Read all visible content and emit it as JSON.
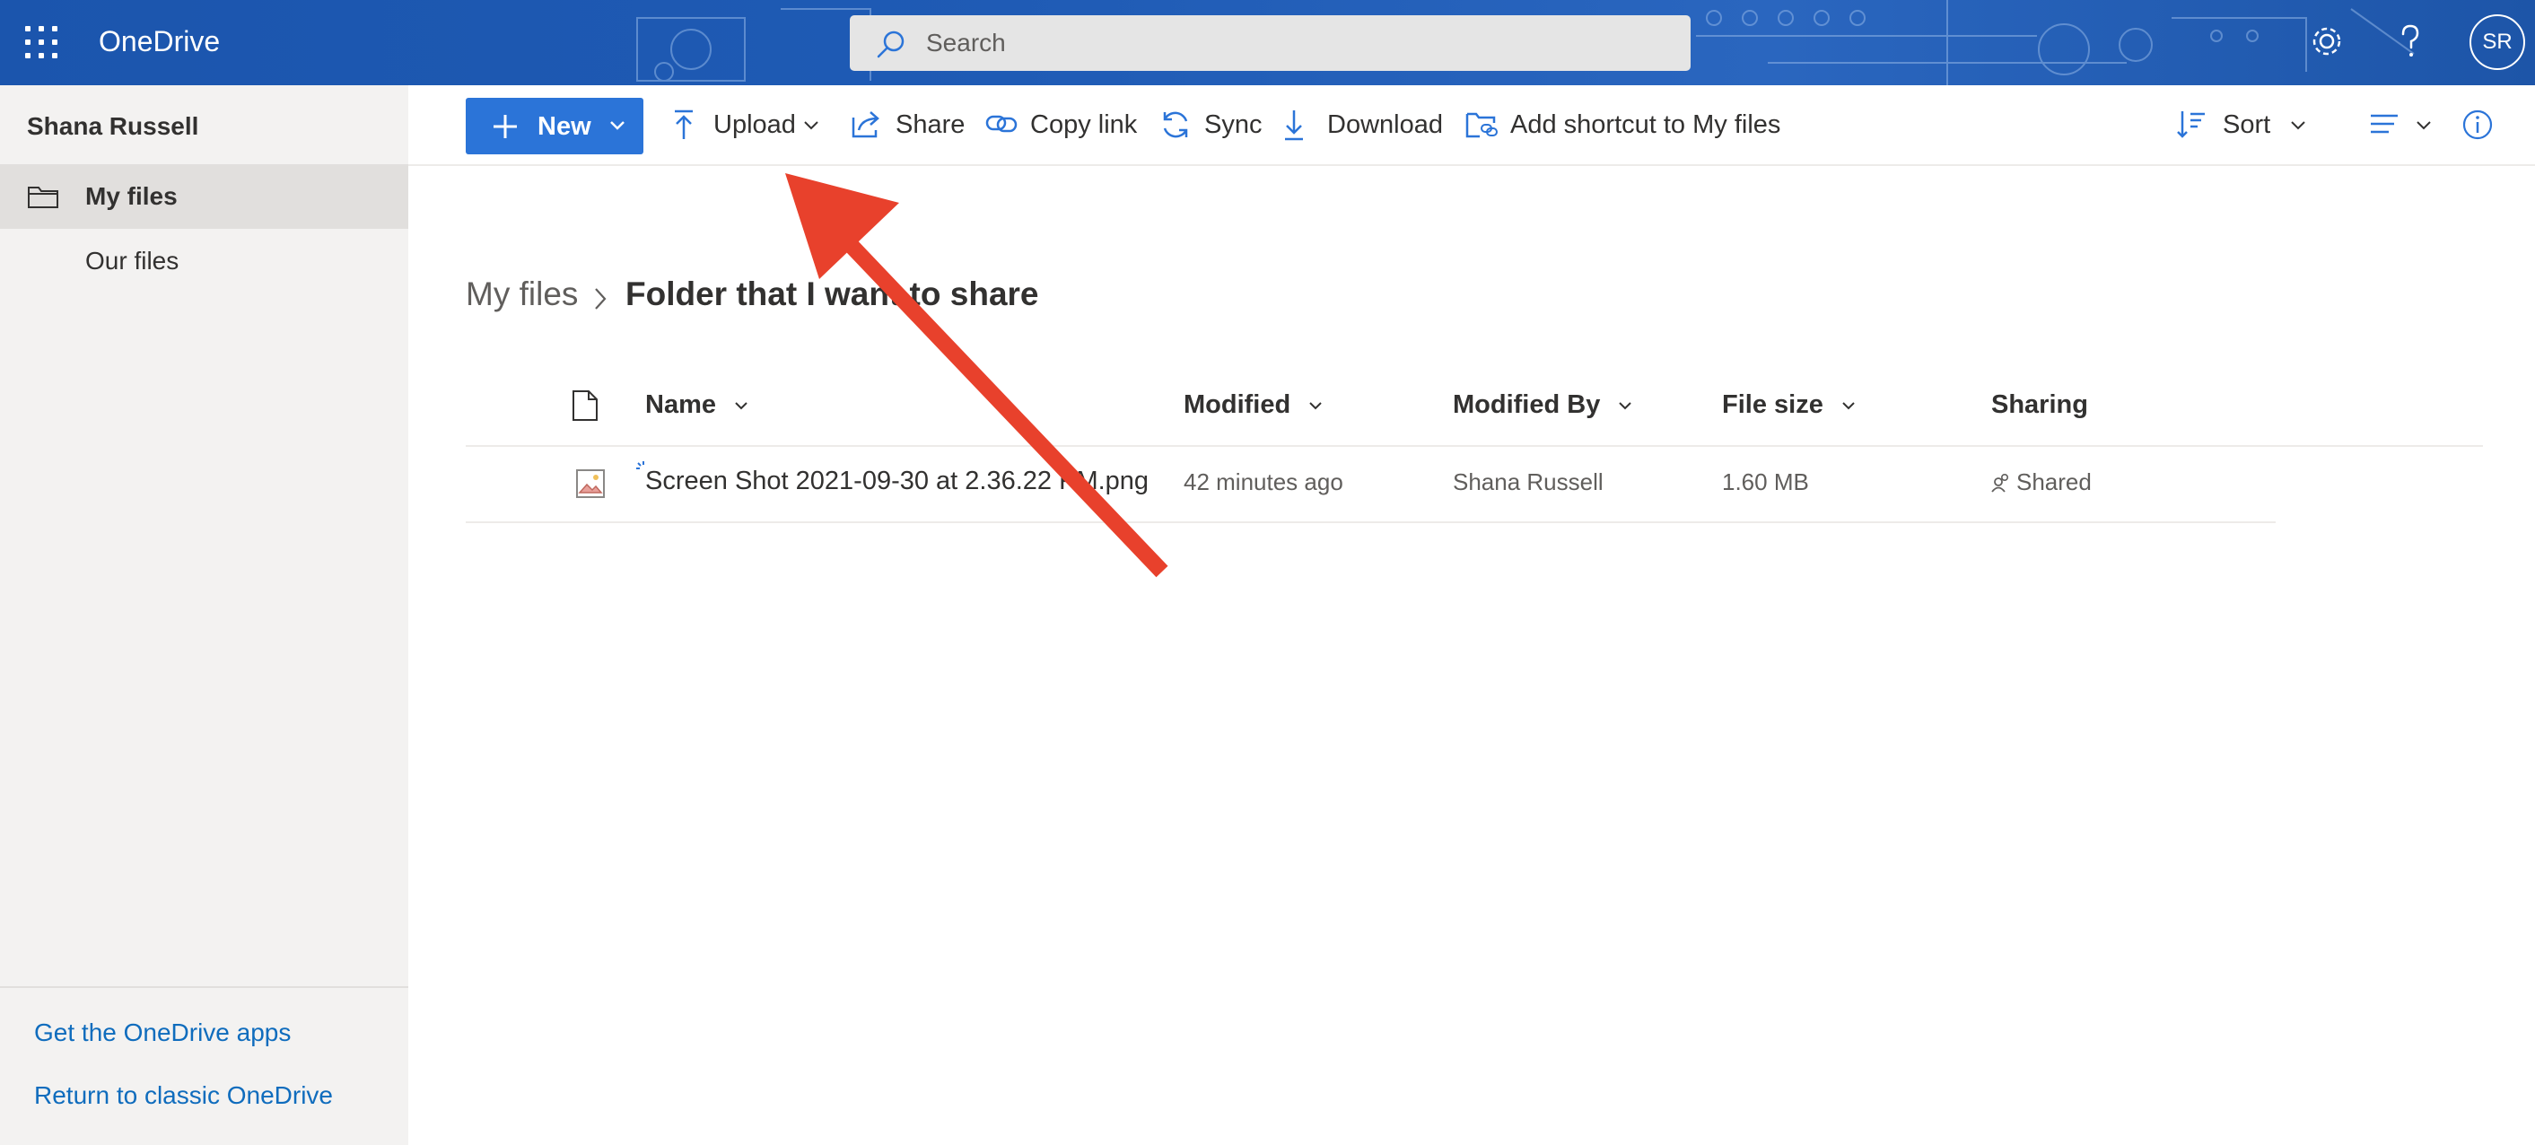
{
  "app": {
    "title": "OneDrive"
  },
  "search": {
    "placeholder": "Search"
  },
  "header": {
    "avatar_initials": "SR",
    "icons": [
      "app-launcher-icon",
      "gear-icon",
      "help-icon"
    ]
  },
  "sidebar": {
    "user_name": "Shana Russell",
    "items": [
      {
        "label": "My files",
        "icon": "folder-icon",
        "active": true
      },
      {
        "label": "Our files"
      }
    ],
    "footer_links": [
      "Get the OneDrive apps",
      "Return to classic OneDrive"
    ]
  },
  "toolbar": {
    "new_label": "New",
    "upload_label": "Upload",
    "share_label": "Share",
    "copy_link_label": "Copy link",
    "sync_label": "Sync",
    "download_label": "Download",
    "add_shortcut_label": "Add shortcut to My files",
    "sort_label": "Sort"
  },
  "breadcrumb": {
    "root": "My files",
    "current": "Folder that I want to share"
  },
  "table": {
    "columns": [
      "Name",
      "Modified",
      "Modified By",
      "File size",
      "Sharing"
    ],
    "rows": [
      {
        "name": "Screen Shot 2021-09-30 at 2.36.22 PM.png",
        "modified": "42 minutes ago",
        "modified_by": "Shana Russell",
        "file_size": "1.60 MB",
        "sharing": "Shared"
      }
    ]
  },
  "colors": {
    "header_bg": "#1f5bb5",
    "accent": "#2b74d8",
    "link": "#0f6cbd",
    "annotation_arrow": "#e8412c"
  }
}
